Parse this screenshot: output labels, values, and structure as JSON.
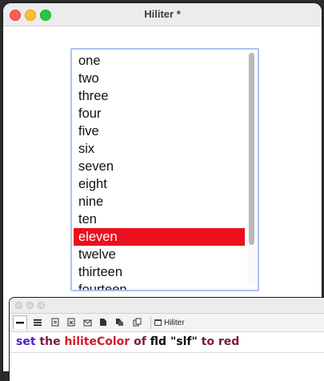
{
  "window": {
    "title": "Hiliter *"
  },
  "list": {
    "lines": [
      "one",
      "two",
      "three",
      "four",
      "five",
      "six",
      "seven",
      "eight",
      "nine",
      "ten",
      "eleven",
      "twelve",
      "thirteen",
      "fourteen"
    ],
    "hilited_line": 11,
    "hilite_color": "#ec0f1d"
  },
  "message_box": {
    "stack_tab_label": "Hiliter",
    "command": {
      "cmd": "set",
      "the": "the",
      "prop": "hiliteColor",
      "of": "of",
      "target": "fld \"slf\"",
      "to": "to",
      "value": "red"
    }
  },
  "colors": {
    "accent_highlight": "#ec0f1d",
    "keyword_command": "#4b1fcf",
    "keyword": "#7a1a3c",
    "property": "#d11a2a"
  }
}
